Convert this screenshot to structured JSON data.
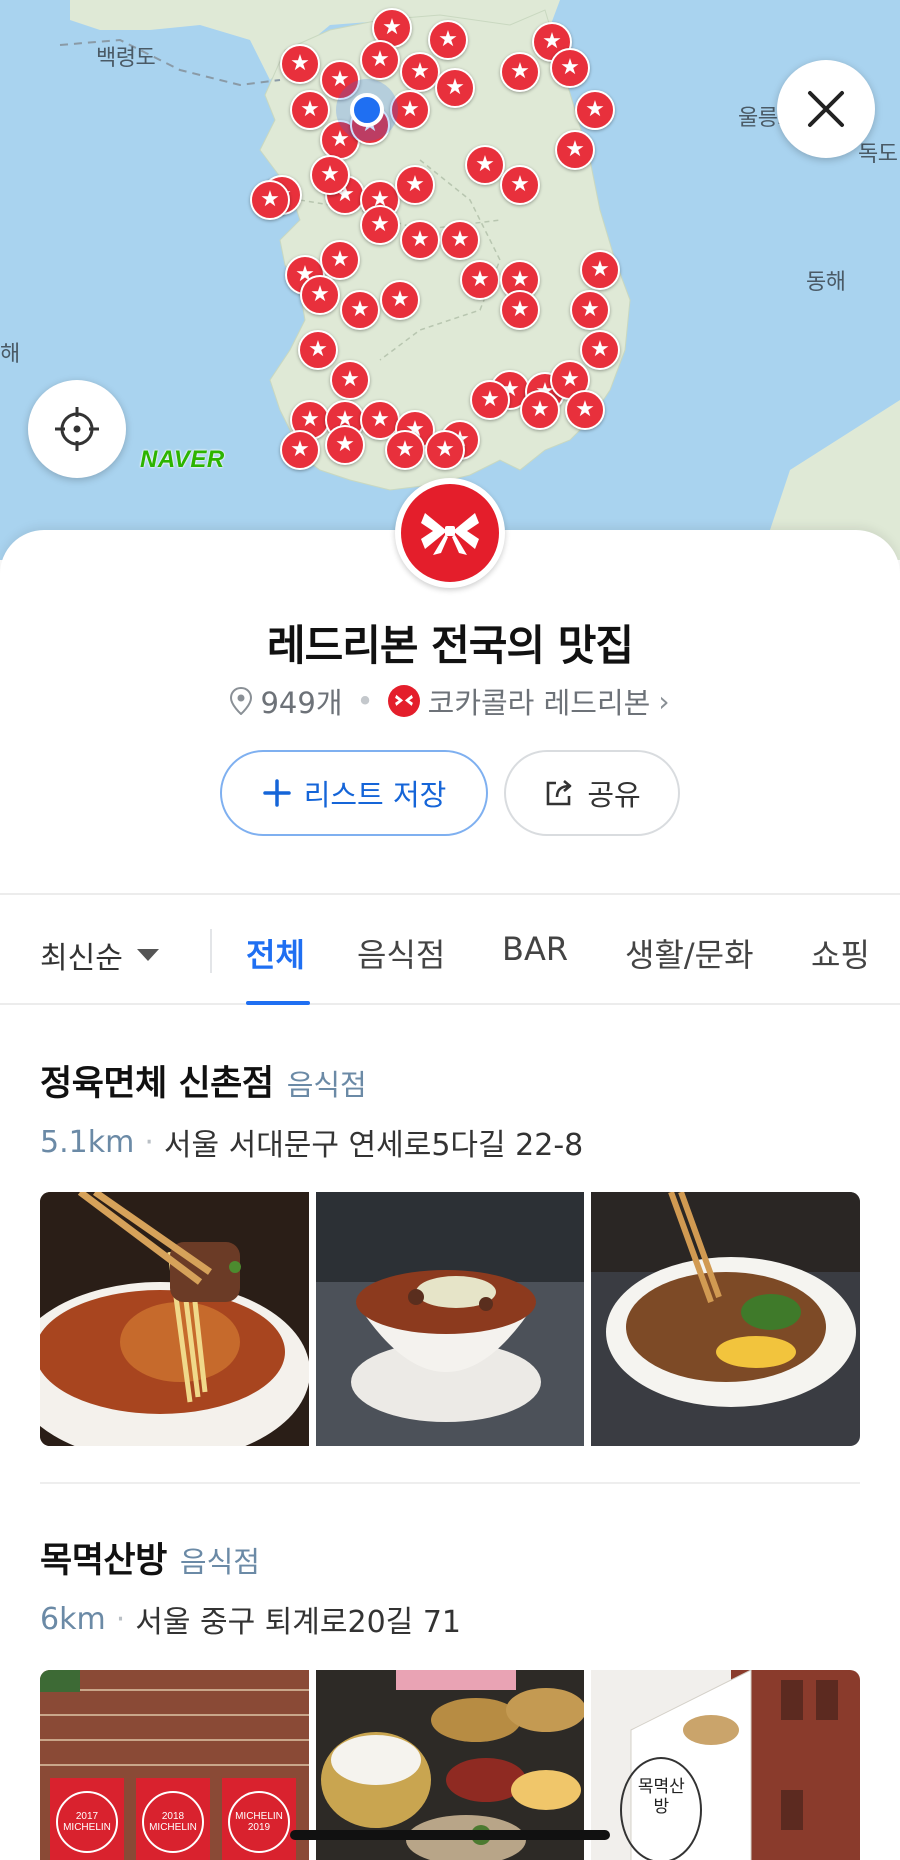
{
  "map": {
    "labels": {
      "baengnyeongdo": "백령도",
      "ulleungdo": "울릉도",
      "dokdo": "독도",
      "east_sea": "동해",
      "west_sea_fragment": "해"
    },
    "provider_logo": "NAVER",
    "close_icon": "close-icon",
    "locate_icon": "crosshair-icon",
    "pin_icon": "star-icon",
    "pin_color": "#e8303c",
    "current_location_color": "#1f6ff2"
  },
  "list": {
    "brand_icon": "ribbon-icon",
    "brand_color": "#e41e2b",
    "title": "레드리본 전국의 맛집",
    "count": "949개",
    "owner": "코카콜라 레드리본",
    "save_label": "리스트 저장",
    "share_label": "공유"
  },
  "filters": {
    "sort_label": "최신순",
    "tabs": [
      {
        "label": "전체",
        "active": true
      },
      {
        "label": "음식점",
        "active": false
      },
      {
        "label": "BAR",
        "active": false
      },
      {
        "label": "생활/문화",
        "active": false
      },
      {
        "label": "쇼핑",
        "active": false
      }
    ]
  },
  "places": [
    {
      "name": "정육면체 신촌점",
      "category": "음식점",
      "distance": "5.1km",
      "address": "서울 서대문구 연세로5다길 22-8"
    },
    {
      "name": "목멱산방",
      "category": "음식점",
      "distance": "6km",
      "address": "서울 중구 퇴계로20길 71",
      "photo_text": {
        "plate1": "2017",
        "plate2": "2018",
        "plate3": "2019",
        "plate_brand": "MICHELIN",
        "sign": "목멱산방"
      }
    }
  ]
}
